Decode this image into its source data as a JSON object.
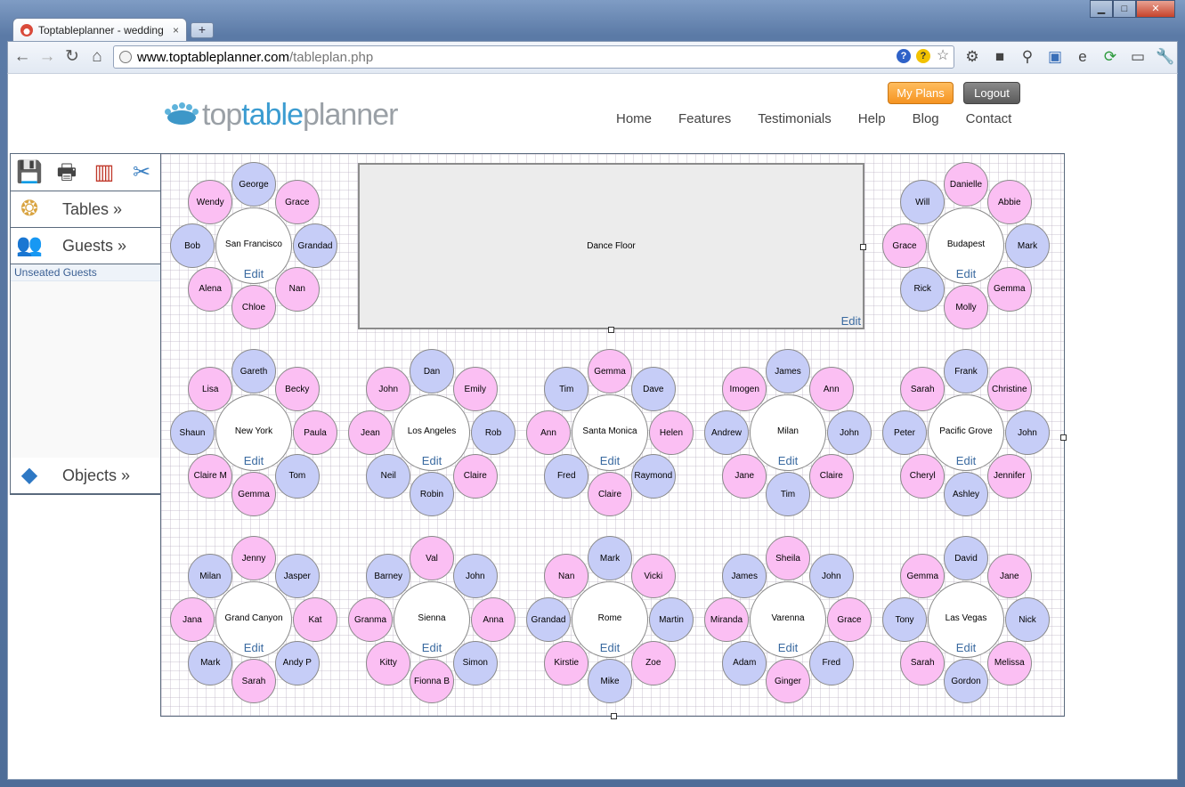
{
  "browser": {
    "tab_title": "Toptableplanner - wedding",
    "tab_close": "×",
    "new_tab": "+",
    "url_host": "www.toptableplanner.com",
    "url_path": "/tableplan.php",
    "window_min": "▁",
    "window_max": "□",
    "window_close": "✕"
  },
  "header": {
    "logo_a": "top",
    "logo_b": "table",
    "logo_c": "planner",
    "my_plans": "My Plans",
    "logout": "Logout",
    "nav": [
      "Home",
      "Features",
      "Testimonials",
      "Help",
      "Blog",
      "Contact"
    ]
  },
  "sidebar": {
    "tables": "Tables »",
    "guests": "Guests »",
    "unseated": "Unseated Guests",
    "objects": "Objects »"
  },
  "plan": {
    "dance_floor": "Dance Floor",
    "edit": "Edit",
    "tables": [
      {
        "name": "San Francisco",
        "seats": [
          [
            "George",
            "m"
          ],
          [
            "Grace",
            "f"
          ],
          [
            "Grandad",
            "m"
          ],
          [
            "Nan",
            "f"
          ],
          [
            "Chloe",
            "f"
          ],
          [
            "Alena",
            "f"
          ],
          [
            "Bob",
            "m"
          ],
          [
            "Wendy",
            "f"
          ]
        ]
      },
      {
        "name": "Budapest",
        "seats": [
          [
            "Danielle",
            "f"
          ],
          [
            "Abbie",
            "f"
          ],
          [
            "Mark",
            "m"
          ],
          [
            "Gemma",
            "f"
          ],
          [
            "Molly",
            "f"
          ],
          [
            "Rick",
            "m"
          ],
          [
            "Grace",
            "f"
          ],
          [
            "Will",
            "m"
          ]
        ]
      },
      {
        "name": "New York",
        "seats": [
          [
            "Gareth",
            "m"
          ],
          [
            "Becky",
            "f"
          ],
          [
            "Paula",
            "f"
          ],
          [
            "Tom",
            "m"
          ],
          [
            "Gemma",
            "f"
          ],
          [
            "Claire M",
            "f"
          ],
          [
            "Shaun",
            "m"
          ],
          [
            "Lisa",
            "f"
          ]
        ]
      },
      {
        "name": "Los Angeles",
        "seats": [
          [
            "Dan",
            "m"
          ],
          [
            "Emily",
            "f"
          ],
          [
            "Rob",
            "m"
          ],
          [
            "Claire",
            "f"
          ],
          [
            "Robin",
            "m"
          ],
          [
            "Neil",
            "m"
          ],
          [
            "Jean",
            "f"
          ],
          [
            "John",
            "f"
          ]
        ]
      },
      {
        "name": "Santa Monica",
        "seats": [
          [
            "Gemma",
            "f"
          ],
          [
            "Dave",
            "m"
          ],
          [
            "Helen",
            "f"
          ],
          [
            "Raymond",
            "m"
          ],
          [
            "Claire",
            "f"
          ],
          [
            "Fred",
            "m"
          ],
          [
            "Ann",
            "f"
          ],
          [
            "Tim",
            "m"
          ]
        ]
      },
      {
        "name": "Milan",
        "seats": [
          [
            "James",
            "m"
          ],
          [
            "Ann",
            "f"
          ],
          [
            "John",
            "m"
          ],
          [
            "Claire",
            "f"
          ],
          [
            "Tim",
            "m"
          ],
          [
            "Jane",
            "f"
          ],
          [
            "Andrew",
            "m"
          ],
          [
            "Imogen",
            "f"
          ]
        ]
      },
      {
        "name": "Pacific Grove",
        "seats": [
          [
            "Frank",
            "m"
          ],
          [
            "Christine",
            "f"
          ],
          [
            "John",
            "m"
          ],
          [
            "Jennifer",
            "f"
          ],
          [
            "Ashley",
            "m"
          ],
          [
            "Cheryl",
            "f"
          ],
          [
            "Peter",
            "m"
          ],
          [
            "Sarah",
            "f"
          ]
        ]
      },
      {
        "name": "Grand Canyon",
        "seats": [
          [
            "Jenny",
            "f"
          ],
          [
            "Jasper",
            "m"
          ],
          [
            "Kat",
            "f"
          ],
          [
            "Andy P",
            "m"
          ],
          [
            "Sarah",
            "f"
          ],
          [
            "Mark",
            "m"
          ],
          [
            "Jana",
            "f"
          ],
          [
            "Milan",
            "m"
          ]
        ]
      },
      {
        "name": "Sienna",
        "seats": [
          [
            "Val",
            "f"
          ],
          [
            "John",
            "m"
          ],
          [
            "Anna",
            "f"
          ],
          [
            "Simon",
            "m"
          ],
          [
            "Fionna B",
            "f"
          ],
          [
            "Kitty",
            "f"
          ],
          [
            "Granma",
            "f"
          ],
          [
            "Barney",
            "m"
          ]
        ]
      },
      {
        "name": "Rome",
        "seats": [
          [
            "Mark",
            "m"
          ],
          [
            "Vicki",
            "f"
          ],
          [
            "Martin",
            "m"
          ],
          [
            "Zoe",
            "f"
          ],
          [
            "Mike",
            "m"
          ],
          [
            "Kirstie",
            "f"
          ],
          [
            "Grandad",
            "m"
          ],
          [
            "Nan",
            "f"
          ]
        ]
      },
      {
        "name": "Varenna",
        "seats": [
          [
            "Sheila",
            "f"
          ],
          [
            "John",
            "m"
          ],
          [
            "Grace",
            "f"
          ],
          [
            "Fred",
            "m"
          ],
          [
            "Ginger",
            "f"
          ],
          [
            "Adam",
            "m"
          ],
          [
            "Miranda",
            "f"
          ],
          [
            "James",
            "m"
          ]
        ]
      },
      {
        "name": "Las Vegas",
        "seats": [
          [
            "David",
            "m"
          ],
          [
            "Jane",
            "f"
          ],
          [
            "Nick",
            "m"
          ],
          [
            "Melissa",
            "f"
          ],
          [
            "Gordon",
            "m"
          ],
          [
            "Sarah",
            "f"
          ],
          [
            "Tony",
            "m"
          ],
          [
            "Gemma",
            "f"
          ]
        ]
      }
    ]
  }
}
